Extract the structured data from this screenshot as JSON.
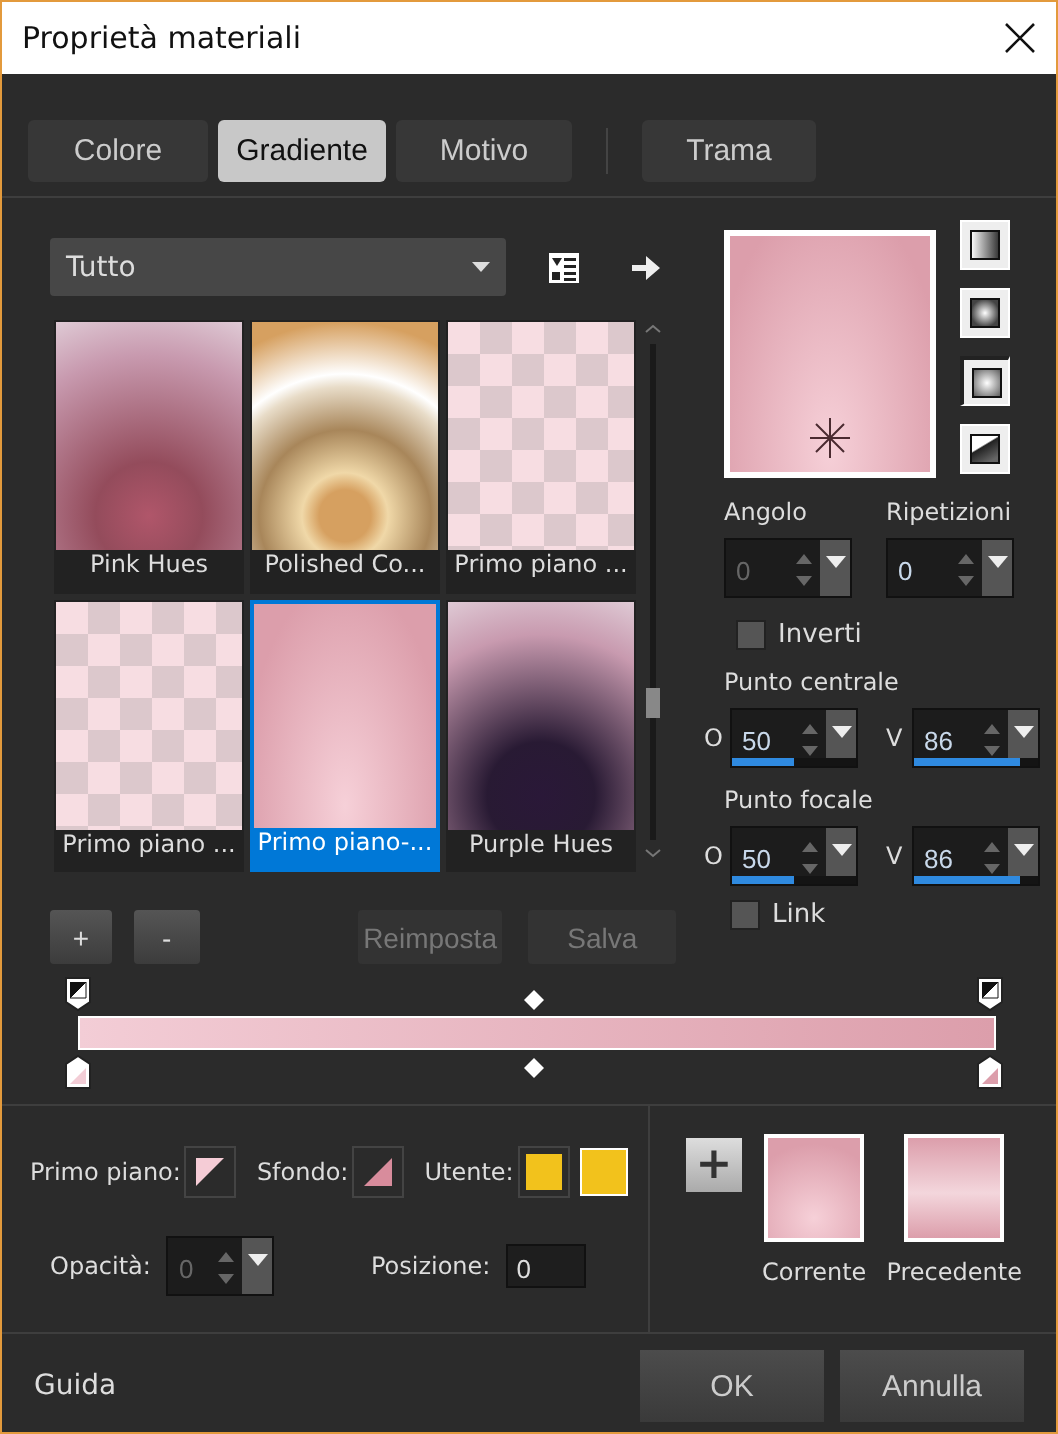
{
  "window": {
    "title": "Proprietà materiali"
  },
  "tabs": [
    {
      "label": "Colore",
      "selected": false
    },
    {
      "label": "Gradiente",
      "selected": true
    },
    {
      "label": "Motivo",
      "selected": false
    },
    {
      "label": "Trama",
      "selected": false
    }
  ],
  "library": {
    "category": "Tutto",
    "gradients": [
      {
        "name": "Pink Hues",
        "kind": "radial",
        "color": "#b0566a",
        "selected": false
      },
      {
        "name": "Polished Co...",
        "kind": "rings",
        "color": "#d6a060",
        "selected": false
      },
      {
        "name": "Primo piano ...",
        "kind": "checker",
        "color": "#f7dde2",
        "selected": false
      },
      {
        "name": "Primo piano ...",
        "kind": "checker",
        "color": "#f7dde2",
        "selected": false
      },
      {
        "name": "Primo piano-...",
        "kind": "linear",
        "color": "#dc9eab",
        "selected": true
      },
      {
        "name": "Purple Hues",
        "kind": "radial",
        "color": "#2a1838",
        "selected": false
      }
    ],
    "buttons": [
      {
        "label": "+",
        "disabled": false
      },
      {
        "label": "-",
        "disabled": false
      },
      {
        "label": "Reimposta",
        "disabled": true
      },
      {
        "label": "Salva",
        "disabled": true
      }
    ]
  },
  "style_buttons": [
    {
      "kind": "linear",
      "selected": false
    },
    {
      "kind": "rectangular",
      "selected": false
    },
    {
      "kind": "sunburst",
      "selected": true
    },
    {
      "kind": "radial",
      "selected": false
    }
  ],
  "angle": {
    "label": "Angolo",
    "value": "0",
    "disabled": true
  },
  "repeats": {
    "label": "Ripetizioni",
    "value": "0",
    "disabled": false
  },
  "invert": {
    "label": "Inverti",
    "checked": false
  },
  "center": {
    "label": "Punto centrale",
    "h": {
      "label": "O",
      "value": "50",
      "level": 0.5
    },
    "v": {
      "label": "V",
      "value": "86",
      "level": 0.86
    }
  },
  "focal": {
    "label": "Punto focale",
    "h": {
      "label": "O",
      "value": "50",
      "level": 0.5
    },
    "v": {
      "label": "V",
      "value": "86",
      "level": 0.86
    }
  },
  "link": {
    "label": "Link",
    "checked": false
  },
  "colors": [
    {
      "label": "Primo piano:",
      "kind": "foreground",
      "color": "#f5ccd6"
    },
    {
      "label": "Sfondo:",
      "kind": "background",
      "color": "#d88c9c"
    },
    {
      "label": "Utente:",
      "kind": "user",
      "color": "#f2c21c"
    }
  ],
  "opacity": {
    "label": "Opacità:",
    "value": "0",
    "disabled": true
  },
  "position": {
    "label": "Posizione:",
    "value": "0"
  },
  "add_button": "+",
  "previews": [
    {
      "label": "Corrente",
      "kind": "radial"
    },
    {
      "label": "Precedente",
      "kind": "band"
    }
  ],
  "footer": {
    "help": "Guida",
    "buttons": [
      "OK",
      "Annulla"
    ]
  }
}
